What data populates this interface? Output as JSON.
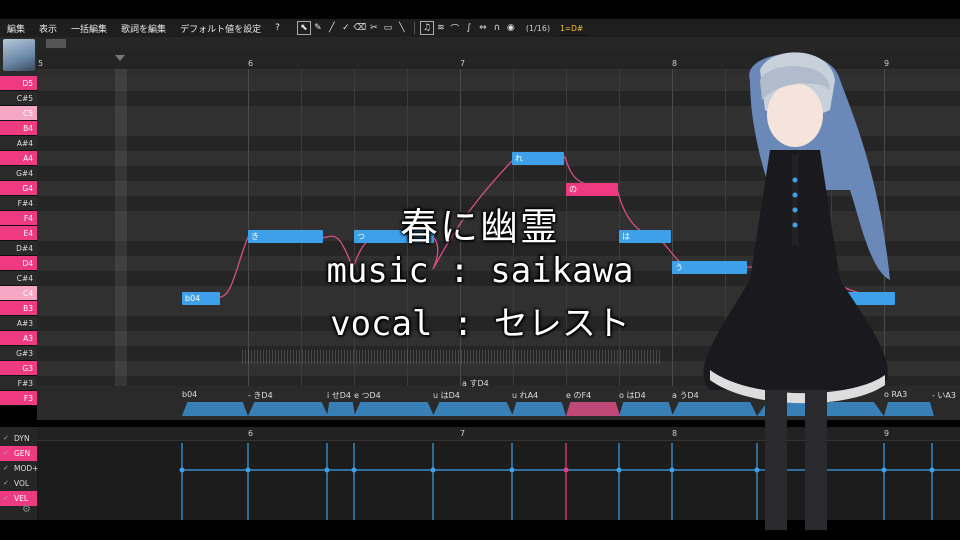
{
  "menu": [
    "編集",
    "表示",
    "一括編集",
    "歌詞を編集",
    "デフォルト値を設定",
    "?"
  ],
  "toolbar": {
    "tools": [
      {
        "icon": "cursor-icon",
        "glyph": "⬉"
      },
      {
        "icon": "pencil-icon",
        "glyph": "✎"
      },
      {
        "icon": "line-icon",
        "glyph": "╱"
      },
      {
        "icon": "vibrato-pen-icon",
        "glyph": "✓"
      },
      {
        "icon": "eraser-icon",
        "glyph": "⌫"
      },
      {
        "icon": "knife-icon",
        "glyph": "✂"
      },
      {
        "icon": "ruler-icon",
        "glyph": "▭"
      },
      {
        "icon": "dropper-icon",
        "glyph": "╲"
      }
    ],
    "pitch_tools": [
      {
        "icon": "note-icon",
        "glyph": "♫"
      },
      {
        "icon": "vibrato-icon",
        "glyph": "≋"
      },
      {
        "icon": "bend-icon",
        "glyph": "⌒"
      },
      {
        "icon": "slide-icon",
        "glyph": "∫"
      },
      {
        "icon": "arrows-icon",
        "glyph": "⇔"
      },
      {
        "icon": "arch-icon",
        "glyph": "∩"
      },
      {
        "icon": "record-icon",
        "glyph": "◉"
      }
    ],
    "quantize": "(1/16)",
    "key": "1=D#"
  },
  "ruler": {
    "measures": [
      "5",
      "6",
      "7",
      "8",
      "9"
    ]
  },
  "piano_keys": [
    "D5",
    "C#5",
    "C5",
    "B4",
    "A#4",
    "A4",
    "G#4",
    "G4",
    "F#4",
    "F4",
    "E4",
    "D#4",
    "D4",
    "C#4",
    "C4",
    "B3",
    "A#3",
    "A3",
    "G#3",
    "G3",
    "F#3",
    "F3"
  ],
  "notes": [
    {
      "lyric": "b04",
      "pink": false
    },
    {
      "lyric": "き",
      "pink": false
    },
    {
      "lyric": "つ",
      "pink": false
    },
    {
      "lyric": "れ",
      "pink": false
    },
    {
      "lyric": "の",
      "pink": true
    },
    {
      "lyric": "は",
      "pink": false
    },
    {
      "lyric": "う",
      "pink": false
    },
    {
      "lyric": "R",
      "pink": false
    }
  ],
  "phonemes": [
    "b04",
    "- きD4",
    "i せD4",
    "e つD4",
    "u はD4",
    "u れA4",
    "e のF4",
    "o はD4",
    "a うD4",
    "u のA",
    "o RA3",
    "- いA3"
  ],
  "phoneme_extra": "a すD4",
  "params": {
    "tabs": [
      {
        "label": "DYN",
        "on": false
      },
      {
        "label": "GEN",
        "on": true
      },
      {
        "label": "MOD+",
        "on": false
      },
      {
        "label": "VOL",
        "on": false
      },
      {
        "label": "VEL",
        "on": true
      }
    ]
  },
  "overlay": {
    "title": "春に幽霊",
    "music": "music : saikawa",
    "vocal": "vocal : セレスト"
  },
  "colors": {
    "accent_pink": "#ee3a80",
    "note_blue": "#3da0e8"
  }
}
